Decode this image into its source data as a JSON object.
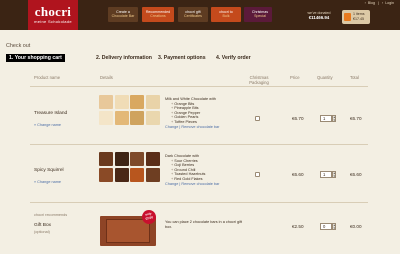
{
  "brand": {
    "name": "chocri",
    "tagline": "meine Schokolade"
  },
  "nav": [
    {
      "label": "Create a",
      "sub": "Chocolate Bar"
    },
    {
      "label": "Recommended",
      "sub": "Creations"
    },
    {
      "label": "chocri gift",
      "sub": "Certificates"
    },
    {
      "label": "chocri to",
      "sub": "Bulk"
    },
    {
      "label": "Christmas",
      "sub": "Special"
    }
  ],
  "topbar": {
    "blog": "Blog",
    "login": "Login",
    "separator": "|",
    "icon": "chevron-right-icon"
  },
  "donated": {
    "label": "we've donated",
    "amount": "€11466.94"
  },
  "cart": {
    "label": "Shopping cart",
    "count": "1 items",
    "total": "€17.45",
    "icon": "shopping-bag-icon"
  },
  "checkout": {
    "title": "Check out",
    "steps": [
      {
        "number": "1.",
        "label": "Your shopping cart"
      },
      {
        "number": "2.",
        "label": "Delivery information"
      },
      {
        "number": "3.",
        "label": "Payment options"
      },
      {
        "number": "4.",
        "label": "Verify order"
      }
    ],
    "columns": {
      "product": "Product name",
      "details": "Details",
      "xmas": "Christmas Packaging",
      "price": "Price",
      "quantity": "Quantity",
      "total": "Total"
    }
  },
  "items": [
    {
      "name": "Treasure Island",
      "change": "» Change name",
      "desc_title": "Milk and White Chocolate with",
      "ingredients": [
        "Orange Bits",
        "Pineapple Bits",
        "Orange Pepper",
        "Golden Pearls",
        "Toffee Pieces"
      ],
      "links": "Change | Remove chocolate bar",
      "price": "€6.70",
      "quantity": "1",
      "total": "€6.70",
      "tile_colors": [
        "#e8c89a",
        "#f0dcb6",
        "#d9a860",
        "#e9d3a8",
        "#f4e5c8",
        "#e3b877",
        "#cfa35e",
        "#ead7ae"
      ]
    },
    {
      "name": "Spicy Squirrel",
      "change": "» Change name",
      "desc_title": "Dark Chocolate with",
      "ingredients": [
        "Sour Cherries",
        "Goji Berries",
        "Ground Chili",
        "Toasted Hazelnuts",
        "Red Gold Flakes"
      ],
      "links": "Change | Remove chocolate bar",
      "price": "€6.60",
      "quantity": "1",
      "total": "€6.60",
      "tile_colors": [
        "#6a3a1e",
        "#3e2414",
        "#7e4a2a",
        "#5a2e18",
        "#8a4a26",
        "#4a2816",
        "#b8561e",
        "#6e3e22"
      ]
    }
  ],
  "giftbox": {
    "section": "chocri recommends",
    "name": "Gift Box",
    "note": "(optional)",
    "badge": "only €2.50",
    "desc": "You can place 2 chocolate bars in a chocri gift box.",
    "price": "€2.50",
    "quantity": "0",
    "total": "€0.00"
  }
}
